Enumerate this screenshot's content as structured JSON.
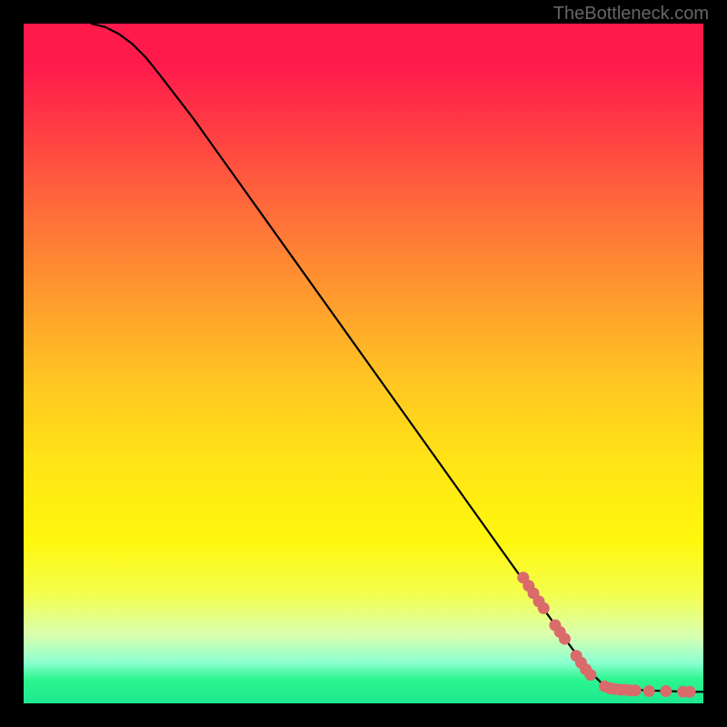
{
  "watermark": "TheBottleneck.com",
  "chart_data": {
    "type": "line",
    "title": "",
    "xlabel": "",
    "ylabel": "",
    "xlim": [
      0,
      100
    ],
    "ylim": [
      0,
      100
    ],
    "curve": {
      "x": [
        10,
        12,
        14,
        16,
        18,
        20,
        25,
        30,
        35,
        40,
        45,
        50,
        55,
        60,
        65,
        70,
        75,
        80,
        83,
        85,
        88,
        90,
        92,
        95,
        98,
        100
      ],
      "y": [
        100,
        99.5,
        98.5,
        97,
        95,
        92.5,
        86,
        79,
        72,
        65,
        58,
        51,
        44,
        37,
        30,
        23,
        16,
        9,
        5,
        3,
        2.2,
        2.0,
        1.9,
        1.8,
        1.7,
        1.7
      ]
    },
    "scatter_series": {
      "name": "markers",
      "color": "#d96b6b",
      "points": [
        {
          "x": 73.5,
          "y": 18.5
        },
        {
          "x": 74.3,
          "y": 17.3
        },
        {
          "x": 75.0,
          "y": 16.2
        },
        {
          "x": 75.8,
          "y": 15.0
        },
        {
          "x": 76.5,
          "y": 14.0
        },
        {
          "x": 78.2,
          "y": 11.5
        },
        {
          "x": 78.9,
          "y": 10.5
        },
        {
          "x": 79.6,
          "y": 9.5
        },
        {
          "x": 81.3,
          "y": 7.0
        },
        {
          "x": 82.0,
          "y": 6.0
        },
        {
          "x": 82.7,
          "y": 5.0
        },
        {
          "x": 83.4,
          "y": 4.2
        },
        {
          "x": 85.5,
          "y": 2.5
        },
        {
          "x": 86.3,
          "y": 2.2
        },
        {
          "x": 87.0,
          "y": 2.1
        },
        {
          "x": 87.8,
          "y": 2.0
        },
        {
          "x": 88.5,
          "y": 2.0
        },
        {
          "x": 89.3,
          "y": 1.9
        },
        {
          "x": 90.0,
          "y": 1.9
        },
        {
          "x": 92.0,
          "y": 1.8
        },
        {
          "x": 94.5,
          "y": 1.8
        },
        {
          "x": 97.0,
          "y": 1.7
        },
        {
          "x": 98.0,
          "y": 1.7
        }
      ]
    }
  }
}
